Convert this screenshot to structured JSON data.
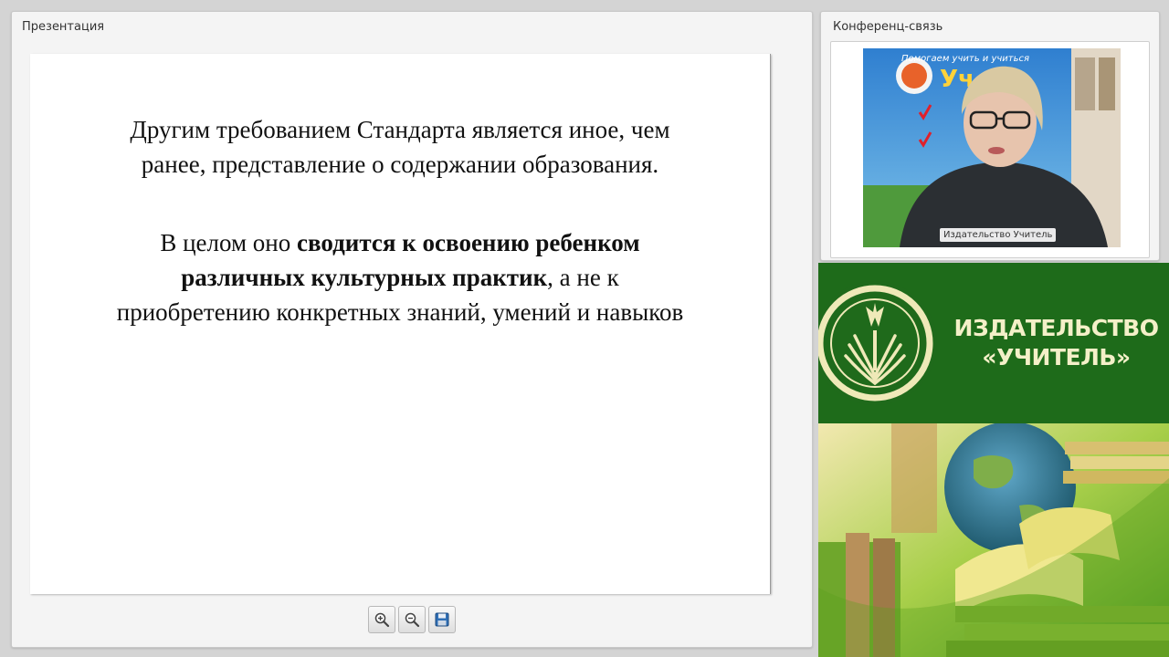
{
  "presentation_panel": {
    "title": "Презентация",
    "slide": {
      "paragraph1": "Другим требованием Стандарта является иное, чем ранее, представление о содержании образования.",
      "paragraph2_prefix": "В целом оно ",
      "paragraph2_bold": "сводится к освоению ребенком различных культурных практик",
      "paragraph2_suffix": ", а не к приобретению конкретных знаний, умений и навыков"
    },
    "toolbar": {
      "zoom_in_icon": "zoom-in-icon",
      "zoom_out_icon": "zoom-out-icon",
      "save_icon": "save-icon"
    }
  },
  "conference_panel": {
    "title": "Конференц-связь",
    "video_label": "Издательство Учитель",
    "poster_top": "Помогаем учить и учиться",
    "poster_logo": "Уч"
  },
  "publisher_banner": {
    "line1": "ИЗДАТЕЛЬСТВО",
    "line2": "«УЧИТЕЛЬ»"
  },
  "colors": {
    "banner_green": "#1e6b1a",
    "banner_text": "#f4f0c8",
    "panel_bg": "#f4f4f4"
  }
}
